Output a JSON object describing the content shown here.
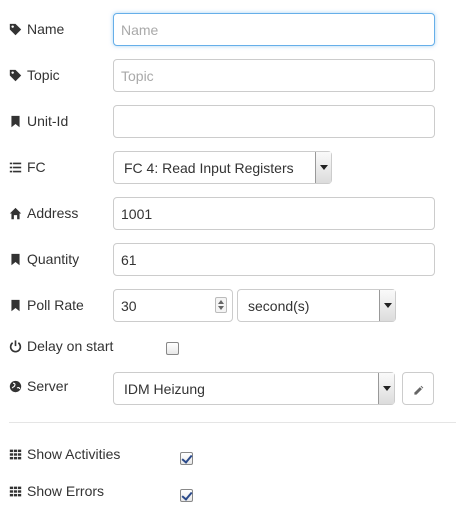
{
  "fields": {
    "name": {
      "label": "Name",
      "value": "",
      "placeholder": "Name",
      "icon": "tag-icon"
    },
    "topic": {
      "label": "Topic",
      "value": "",
      "placeholder": "Topic",
      "icon": "tag-icon"
    },
    "unit_id": {
      "label": "Unit-Id",
      "value": "",
      "placeholder": "",
      "icon": "bookmark-icon"
    },
    "fc": {
      "label": "FC",
      "selected": "FC 4: Read Input Registers",
      "icon": "list-icon"
    },
    "address": {
      "label": "Address",
      "value": "1001",
      "icon": "home-icon"
    },
    "quantity": {
      "label": "Quantity",
      "value": "61",
      "icon": "bookmark-icon"
    },
    "poll_rate": {
      "label": "Poll Rate",
      "value": "30",
      "unit_selected": "second(s)",
      "icon": "bookmark-icon"
    },
    "delay_on_start": {
      "label": "Delay on start",
      "checked": false,
      "icon": "power-icon"
    },
    "server": {
      "label": "Server",
      "selected": "IDM Heizung",
      "icon": "globe-icon",
      "edit_icon": "pencil-icon"
    },
    "show_activities": {
      "label": "Show Activities",
      "checked": true,
      "icon": "grid-icon"
    },
    "show_errors": {
      "label": "Show Errors",
      "checked": true,
      "icon": "grid-icon"
    }
  },
  "colors": {
    "focus_border": "#66afe9",
    "checkmark": "#2b4a8a",
    "label_text": "#333333",
    "placeholder": "#a9a9a9"
  }
}
